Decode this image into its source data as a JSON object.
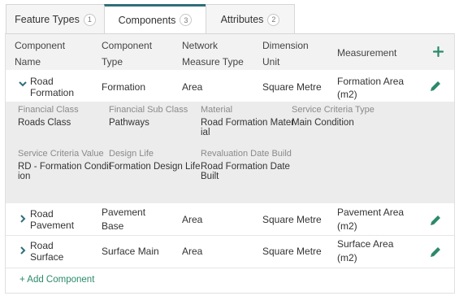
{
  "tabs": [
    {
      "label": "Feature Types",
      "count": "1"
    },
    {
      "label": "Components",
      "count": "3"
    },
    {
      "label": "Attributes",
      "count": "2"
    }
  ],
  "header": {
    "col1_line1": "Component",
    "col1_line2": "Name",
    "col2_line1": "Component",
    "col2_line2": "Type",
    "col3_line1": "Network",
    "col3_line2": "Measure Type",
    "col4_line1": "Dimension",
    "col4_line2": "Unit",
    "col5": "Measurement"
  },
  "rows": [
    {
      "name_line1": "Road",
      "name_line2": "Formation",
      "type_line1": "Formation",
      "type_line2": "",
      "network": "Area",
      "unit": "Square Metre",
      "measure_line1": "Formation Area",
      "measure_line2": "(m2)"
    },
    {
      "name_line1": "Road",
      "name_line2": "Pavement",
      "type_line1": "Pavement",
      "type_line2": "Base",
      "network": "Area",
      "unit": "Square Metre",
      "measure_line1": "Pavement Area",
      "measure_line2": "(m2)"
    },
    {
      "name_line1": "Road",
      "name_line2": "Surface",
      "type_line1": "Surface Main",
      "type_line2": "",
      "network": "Area",
      "unit": "Square Metre",
      "measure_line1": "Surface Area",
      "measure_line2": "(m2)"
    }
  ],
  "detail": {
    "financial_class_label": "Financial Class",
    "financial_class_value": "Roads Class",
    "financial_sub_class_label": "Financial Sub Class",
    "financial_sub_class_value": "Pathways",
    "material_label": "Material",
    "material_value_line1": "Road Formation Mater",
    "material_value_line2": "ial",
    "service_criteria_type_label": "Service Criteria Type",
    "service_criteria_type_value": "Main Condition",
    "service_criteria_value_label": "Service Criteria Value",
    "service_criteria_value_line1": "RD - Formation Condit",
    "service_criteria_value_line2": "ion",
    "design_life_label": "Design Life",
    "design_life_value": "Formation Design Life",
    "revaluation_label": "Revaluation Date Build",
    "revaluation_value_line1": "Road Formation Date",
    "revaluation_value_line2": "Built"
  },
  "add_component_label": "+ Add Component",
  "colors": {
    "accent": "#2b8a6a",
    "tab_active_border": "#2f6f7a",
    "header_bg": "#f2f2f2",
    "detail_bg": "#ececec"
  },
  "icons": {
    "add": "plus-icon",
    "edit": "pencil-icon",
    "expand": "chevron-icon"
  }
}
